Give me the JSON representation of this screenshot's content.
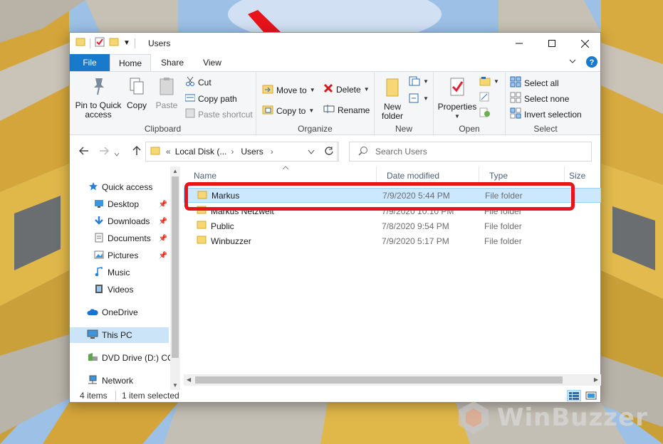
{
  "window": {
    "title": "Users",
    "tabs": {
      "file": "File",
      "home": "Home",
      "share": "Share",
      "view": "View"
    }
  },
  "ribbon": {
    "clipboard": {
      "label": "Clipboard",
      "pin": "Pin to Quick access",
      "copy": "Copy",
      "paste": "Paste",
      "cut": "Cut",
      "copy_path": "Copy path",
      "paste_shortcut": "Paste shortcut"
    },
    "organize": {
      "label": "Organize",
      "move_to": "Move to",
      "copy_to": "Copy to",
      "delete": "Delete",
      "rename": "Rename"
    },
    "new": {
      "label": "New",
      "new_folder": "New folder"
    },
    "open": {
      "label": "Open",
      "properties": "Properties"
    },
    "select": {
      "label": "Select",
      "select_all": "Select all",
      "select_none": "Select none",
      "invert": "Invert selection"
    }
  },
  "address": {
    "crumbs": [
      "«",
      "Local Disk (...",
      "Users"
    ],
    "search_placeholder": "Search Users"
  },
  "nav": {
    "quick_access": "Quick access",
    "items": [
      "Desktop",
      "Downloads",
      "Documents",
      "Pictures",
      "Music",
      "Videos"
    ],
    "onedrive": "OneDrive",
    "this_pc": "This PC",
    "dvd": "DVD Drive (D:) CC",
    "network": "Network"
  },
  "columns": {
    "name": "Name",
    "date": "Date modified",
    "type": "Type",
    "size": "Size"
  },
  "files": [
    {
      "name": "Markus",
      "date": "7/9/2020 5:44 PM",
      "type": "File folder"
    },
    {
      "name": "Markus Netzwelt",
      "date": "7/9/2020 10:10 PM",
      "type": "File folder"
    },
    {
      "name": "Public",
      "date": "7/8/2020 9:54 PM",
      "type": "File folder"
    },
    {
      "name": "Winbuzzer",
      "date": "7/9/2020 5:17 PM",
      "type": "File folder"
    }
  ],
  "status": {
    "count": "4 items",
    "selected": "1 item selected"
  },
  "watermark": "WinBuzzer",
  "colors": {
    "accent": "#1979ca",
    "selection": "#cce8ff",
    "annotation": "#e8141b"
  }
}
